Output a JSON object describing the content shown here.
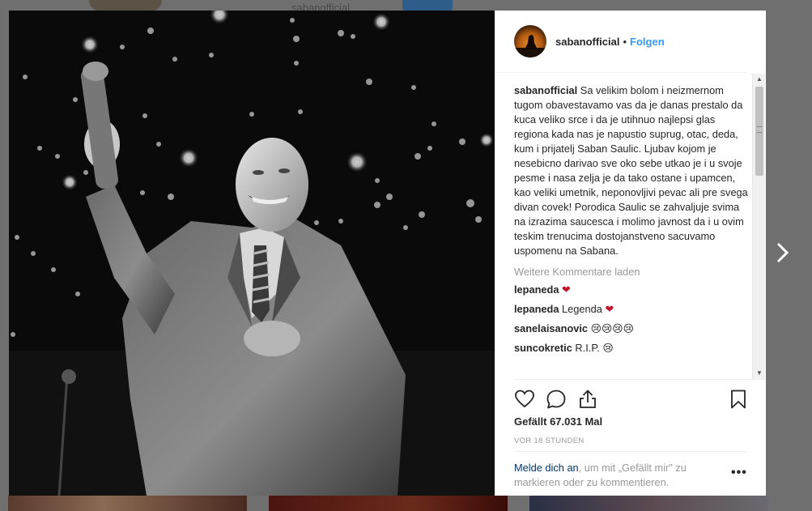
{
  "background": {
    "username": "sabanofficial",
    "follow_color": "#3897f0"
  },
  "post": {
    "username": "sabanofficial",
    "follow_label": "Folgen",
    "separator": "•",
    "caption_user": "sabanofficial",
    "caption_text": "Sa velikim bolom i neizmernom tugom obavestavamo vas da je danas prestalo da kuca veliko srce i da je utihnuo najlepsi glas regiona kada nas je napustio suprug, otac, deda, kum i prijatelj Saban Saulic. Ljubav kojom je nesebicno darivao sve oko sebe utkao je i u svoje pesme i nasa zelja je da tako ostane i upamcen, kao veliki umetnik, neponovljivi pevac ali pre svega divan covek! Porodica Saulic se zahvaljuje svima na izrazima saucesca i molimo javnost da i u ovim teskim trenucima dostojanstveno sacuvamo uspomenu na Sabana.",
    "load_more": "Weitere Kommentare laden",
    "comments": [
      {
        "user": "lepaneda",
        "text": "",
        "emoji": "❤"
      },
      {
        "user": "lepaneda",
        "text": "Legenda",
        "emoji": "❤"
      },
      {
        "user": "sanelaisanovic",
        "text": "",
        "emoji": "😢😢😢😢"
      },
      {
        "user": "suncokretic",
        "text": "R.I.P.",
        "emoji": "😢"
      }
    ],
    "likes": "Gefällt 67.031 Mal",
    "time": "VOR 18 STUNDEN",
    "login_link": "Melde dich an",
    "login_text": ", um mit „Gefällt mir\" zu markieren oder zu kommentieren.",
    "more_options": "•••"
  },
  "icons": {
    "like": "heart-icon",
    "comment": "comment-icon",
    "share": "share-icon",
    "save": "bookmark-icon",
    "next": "chevron-right-icon"
  },
  "colors": {
    "heart": "#c4122f",
    "link": "#003569",
    "muted": "#999999"
  }
}
